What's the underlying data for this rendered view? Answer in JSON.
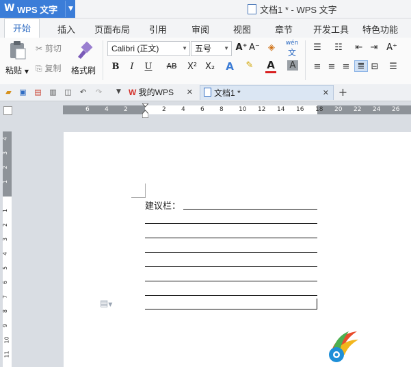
{
  "app": {
    "logo": "W",
    "name": "WPS 文字",
    "window_title": "文档1 * - WPS 文字"
  },
  "menu": [
    "开始",
    "插入",
    "页面布局",
    "引用",
    "审阅",
    "视图",
    "章节",
    "开发工具",
    "特色功能"
  ],
  "ribbon": {
    "paste": "粘贴",
    "cut": "剪切",
    "copy": "复制",
    "format_painter": "格式刷",
    "font_name": "Calibri (正文)",
    "font_size": "五号",
    "bold": "B",
    "italic": "I",
    "underline": "U",
    "strikethrough": "AB",
    "superscript": "X²",
    "subscript": "X₂",
    "font_color_letter": "A",
    "grow_font": "A⁺",
    "shrink_font": "A⁻",
    "pinyin": "wén"
  },
  "tabs": {
    "my_wps": "我的WPS",
    "doc": "文档1 *",
    "add": "+"
  },
  "ruler": {
    "h_left": [
      "6",
      "4",
      "2"
    ],
    "h_right": [
      "2",
      "4",
      "6",
      "8",
      "10",
      "12",
      "14",
      "16",
      "18",
      "20",
      "22",
      "24",
      "26"
    ],
    "v_top": [
      "4",
      "3",
      "2",
      "1"
    ],
    "v_bottom": [
      "1",
      "2",
      "3",
      "4",
      "5",
      "6",
      "7",
      "8",
      "9",
      "10",
      "11"
    ]
  },
  "document": {
    "label": "建议栏："
  },
  "colors": {
    "accent": "#3b7dd8",
    "ruler": "#8e9399"
  }
}
